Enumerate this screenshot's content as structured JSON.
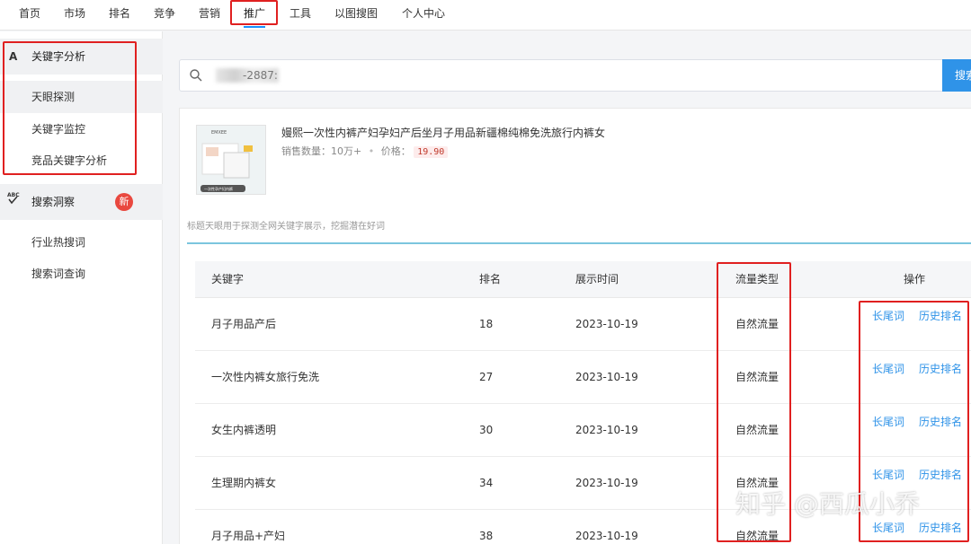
{
  "nav": {
    "items": [
      "首页",
      "市场",
      "排名",
      "竞争",
      "营销",
      "推广",
      "工具",
      "以图搜图",
      "个人中心"
    ],
    "active": "推广"
  },
  "sidebar": {
    "group1": {
      "icon": "A",
      "label": "关键字分析"
    },
    "group1_items": [
      "天眼探测",
      "关键字监控",
      "竞品关键字分析"
    ],
    "group2": {
      "icon": "abc-check-icon",
      "label": "搜索洞察",
      "badge": "新"
    },
    "group2_items": [
      "行业热搜词",
      "搜索词查询"
    ]
  },
  "search": {
    "value": "-2887:",
    "button": "搜索"
  },
  "product": {
    "title": "嫚熙一次性内裤产妇孕妇产后坐月子用品新疆棉纯棉免洗旅行内裤女",
    "sales_label": "销售数量：10万+",
    "price_label": "价格：",
    "price": "19.90",
    "thumb_brand": "EMXEE",
    "thumb_caption": "一次性孕产妇内裤"
  },
  "hint": "标题天眼用于探测全网关键字展示，挖掘潜在好词",
  "table": {
    "headers": [
      "关键字",
      "排名",
      "展示时间",
      "流量类型",
      "操作"
    ],
    "rows": [
      {
        "keyword": "月子用品产后",
        "rank": "18",
        "date": "2023-10-19",
        "traffic": "自然流量",
        "op1": "长尾词",
        "op2": "历史排名"
      },
      {
        "keyword": "一次性内裤女旅行免洗",
        "rank": "27",
        "date": "2023-10-19",
        "traffic": "自然流量",
        "op1": "长尾词",
        "op2": "历史排名"
      },
      {
        "keyword": "女生内裤透明",
        "rank": "30",
        "date": "2023-10-19",
        "traffic": "自然流量",
        "op1": "长尾词",
        "op2": "历史排名"
      },
      {
        "keyword": "生理期内裤女",
        "rank": "34",
        "date": "2023-10-19",
        "traffic": "自然流量",
        "op1": "长尾词",
        "op2": "历史排名"
      },
      {
        "keyword": "月子用品+产妇",
        "rank": "38",
        "date": "2023-10-19",
        "traffic": "自然流量",
        "op1": "长尾词",
        "op2": "历史排名"
      }
    ]
  },
  "watermark": "知乎 @西瓜小乔",
  "colors": {
    "accent": "#2f93e8",
    "highlight_box": "#e02020",
    "badge": "#e9483f"
  }
}
